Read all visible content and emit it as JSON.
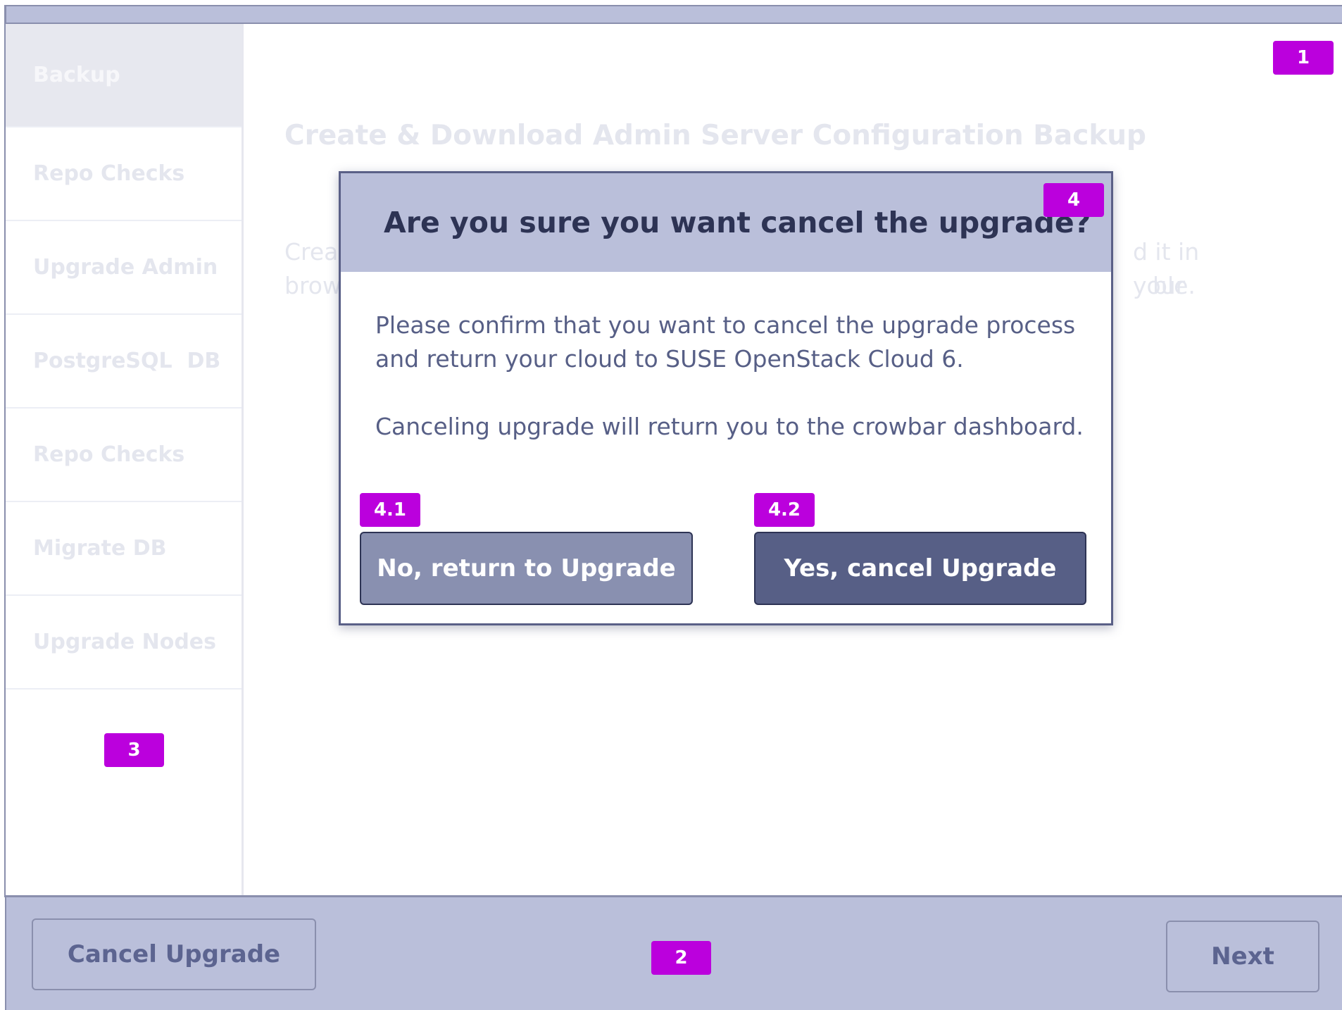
{
  "sidebar": {
    "items": [
      {
        "label": "Backup"
      },
      {
        "label": "Repo Checks"
      },
      {
        "label": "Upgrade Admin"
      },
      {
        "label": "PostgreSQL  DB"
      },
      {
        "label": "Repo Checks"
      },
      {
        "label": "Migrate DB"
      },
      {
        "label": "Upgrade Nodes"
      }
    ]
  },
  "main": {
    "title": "Create & Download Admin Server Configuration Backup",
    "para_line1_left": "Crea",
    "para_line1_right": "d it in your",
    "para_line2_left": "brow",
    "para_line2_right": "ble."
  },
  "footer": {
    "cancel_label": "Cancel Upgrade",
    "next_label": "Next"
  },
  "dialog": {
    "title": "Are you sure you want cancel the upgrade?",
    "message1": "Please confirm that you want to cancel the upgrade process and return your cloud to SUSE OpenStack Cloud 6.",
    "message2": "Canceling upgrade will return you to the crowbar dashboard.",
    "no_label": "No, return to Upgrade",
    "yes_label": "Yes, cancel Upgrade"
  },
  "badges": {
    "b1": "1",
    "b2": "2",
    "b3": "3",
    "b4": "4",
    "b41": "4.1",
    "b42": "4.2"
  },
  "colors": {
    "accent_badge": "#bb00dd",
    "header_bg": "#babfda",
    "primary_button": "#575f86",
    "secondary_button": "#8990b0"
  }
}
